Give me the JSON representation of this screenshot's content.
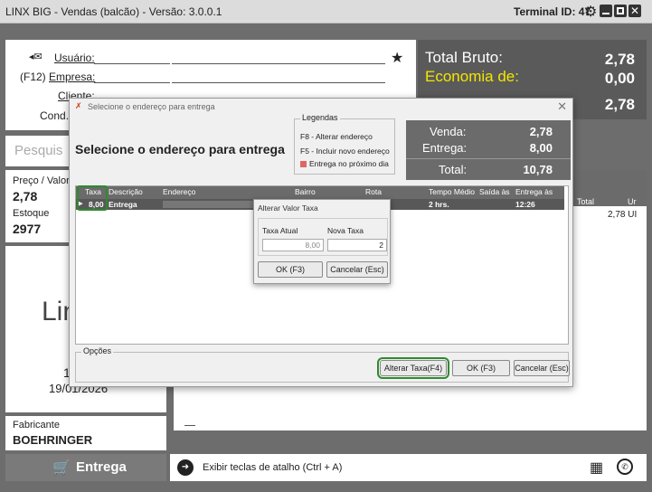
{
  "window": {
    "title": "LINX BIG - Vendas (balcão) - Versão: 3.0.0.1",
    "terminal": "Terminal ID: 47"
  },
  "form": {
    "usuario_label": "Usuário:",
    "empresa_prefix": "(F12)",
    "empresa_label": "Empresa:",
    "cliente_label": "Cliente:",
    "cond_label": "Cond. P"
  },
  "totals": {
    "bruto_label": "Total Bruto:",
    "bruto_value": "2,78",
    "economia_label": "Economia de:",
    "economia_value": "0,00",
    "total_value": "2,78"
  },
  "search_placeholder": "Pesquis",
  "product": {
    "preco_label": "Preço / Valor",
    "preco_value": "2,78",
    "estoque_label": "Estoque",
    "estoque_value": "2977",
    "logo_text": "Lin",
    "date_fragment": "1",
    "date": "19/01/2026",
    "fabricante_label": "Fabricante",
    "fabricante_value": "BOEHRINGER"
  },
  "items_table": {
    "col_total": "Total",
    "col_un": "Ur",
    "value": "2,78 UI"
  },
  "entrega_button": "Entrega",
  "bottom": {
    "shortcut_text": "Exibir teclas de atalho (Ctrl + A)"
  },
  "dialog": {
    "caption": "Selecione o endereço para entrega",
    "title": "Selecione o endereço para entrega",
    "legend": {
      "title": "Legendas",
      "f8": "F8 - Alterar endereço",
      "f5": "F5 - Incluir novo endereço",
      "next_day": "Entrega no próximo dia",
      "next_day_color": "#e06666"
    },
    "summary": {
      "venda_label": "Venda:",
      "venda_value": "2,78",
      "entrega_label": "Entrega:",
      "entrega_value": "8,00",
      "total_label": "Total:",
      "total_value": "10,78"
    },
    "grid": {
      "columns": [
        "Taxa",
        "Descrição",
        "Endereço",
        "Bairro",
        "Rota",
        "Tempo Médio",
        "Saída às",
        "Entrega às"
      ],
      "row": {
        "taxa": "8,00",
        "descricao": "Entrega",
        "tempo": "2 hrs.",
        "entrega_as": "12:26"
      }
    },
    "options_label": "Opções",
    "buttons": {
      "alterar_taxa": "Alterar Taxa(F4)",
      "ok": "OK (F3)",
      "cancelar": "Cancelar (Esc)"
    }
  },
  "taxa_dialog": {
    "caption": "Alterar Valor Taxa",
    "atual_label": "Taxa Atual",
    "atual_value": "8,00",
    "nova_label": "Nova Taxa",
    "nova_value": "2",
    "ok": "OK (F3)",
    "cancelar": "Cancelar (Esc)"
  }
}
